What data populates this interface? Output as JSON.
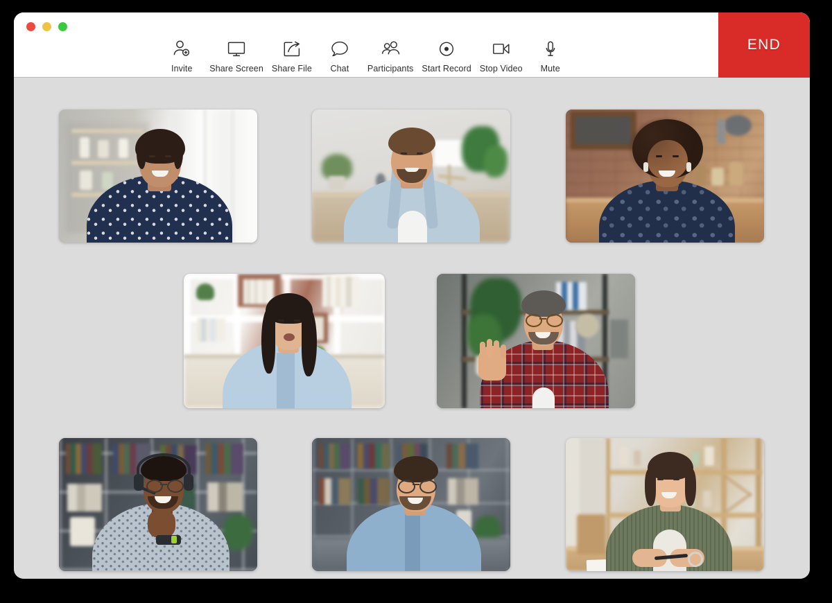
{
  "window": {
    "traffic_lights": [
      {
        "name": "close",
        "color": "#ed4a41"
      },
      {
        "name": "minimize",
        "color": "#efc344"
      },
      {
        "name": "maximize",
        "color": "#3bc940"
      }
    ],
    "background_color": "#dcdcdc",
    "header_background": "#ffffff"
  },
  "toolbar": {
    "items": [
      {
        "label": "Invite",
        "icon": "invite-person-add-icon"
      },
      {
        "label": "Share Screen",
        "icon": "monitor-icon"
      },
      {
        "label": "Share File",
        "icon": "share-arrow-box-icon"
      },
      {
        "label": "Chat",
        "icon": "speech-bubble-icon"
      },
      {
        "label": "Participants",
        "icon": "people-group-icon"
      },
      {
        "label": "Start Record",
        "icon": "record-dot-circle-icon"
      },
      {
        "label": "Stop Video",
        "icon": "video-camera-icon"
      },
      {
        "label": "Mute",
        "icon": "microphone-icon"
      }
    ]
  },
  "end_call": {
    "label": "END",
    "color": "#d92b27"
  },
  "grid": {
    "participants": [
      {
        "id": "p1",
        "name": "participant-1",
        "row": 1,
        "col": 1,
        "scene": "p1",
        "description": "smiling woman in navy polka-dot blouse, bright room with shelves and curtain"
      },
      {
        "id": "p2",
        "name": "participant-2",
        "row": 1,
        "col": 2,
        "scene": "p2",
        "description": "bearded man in light blue shirt, living room with lamp and plant"
      },
      {
        "id": "p3",
        "name": "participant-3",
        "row": 1,
        "col": 3,
        "scene": "p3",
        "description": "woman with curly hair in navy top, brick kitchen background"
      },
      {
        "id": "p4",
        "name": "participant-4",
        "row": 2,
        "col": 1,
        "scene": "p4",
        "description": "woman with long dark hair in light blue shirt, white shelves with books"
      },
      {
        "id": "p5",
        "name": "participant-5",
        "row": 2,
        "col": 2,
        "scene": "p5",
        "description": "man with glasses in red plaid shirt waving, office shelf with binders and plant"
      },
      {
        "id": "p6",
        "name": "participant-6",
        "row": 3,
        "col": 1,
        "scene": "p6",
        "description": "man with headset and glasses in patterned shirt, dark bookshelf"
      },
      {
        "id": "p7",
        "name": "participant-7",
        "row": 3,
        "col": 2,
        "scene": "p7",
        "description": "man with glasses in blue shirt, grey bookshelf background"
      },
      {
        "id": "p8",
        "name": "participant-8",
        "row": 3,
        "col": 3,
        "scene": "p8",
        "description": "woman in green cardigan at desk with pen and paper, wooden shelves"
      }
    ]
  }
}
